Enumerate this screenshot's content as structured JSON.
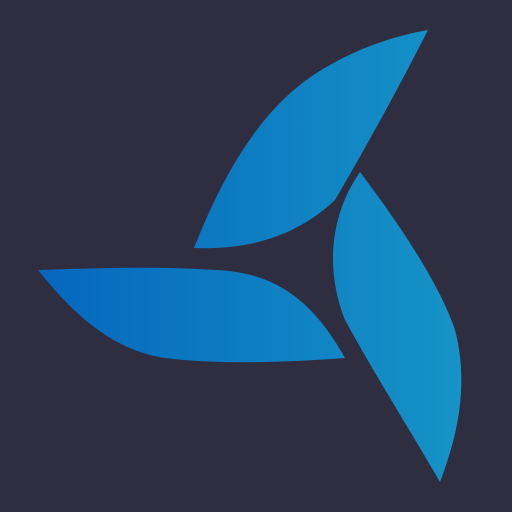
{
  "background_color": "#2f2e41",
  "logo": {
    "icon": "pinwheel-logo-icon",
    "blade_count": 3,
    "gradient_start": "#0567bd",
    "gradient_end": "#1693c7"
  }
}
